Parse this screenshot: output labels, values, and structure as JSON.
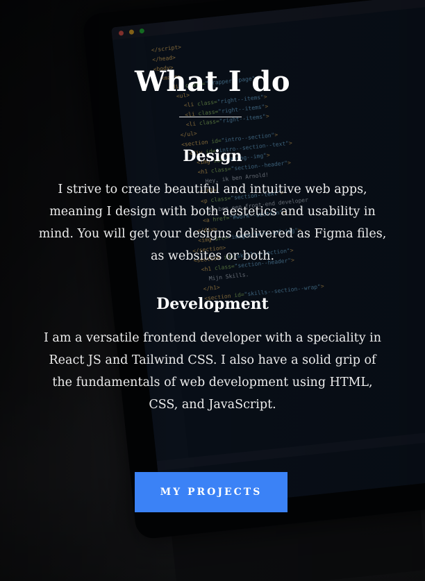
{
  "section": {
    "title": "What I do"
  },
  "services": [
    {
      "heading": "Design",
      "text": "I strive to create beautiful and intuitive web apps, meaning I design with both aestetics and usability in mind. You will get your designs delivered as Figma files, as websites or both."
    },
    {
      "heading": "Development",
      "text": "I am a versatile frontend developer with a speciality in React JS and Tailwind CSS. I also have a solid grip of the fundamentals of web development using HTML, CSS, and JavaScript."
    }
  ],
  "cta": {
    "label": "MY PROJECTS",
    "color": "#3b82f6"
  },
  "background": {
    "description_icon": "laptop-with-code-editor-image"
  }
}
